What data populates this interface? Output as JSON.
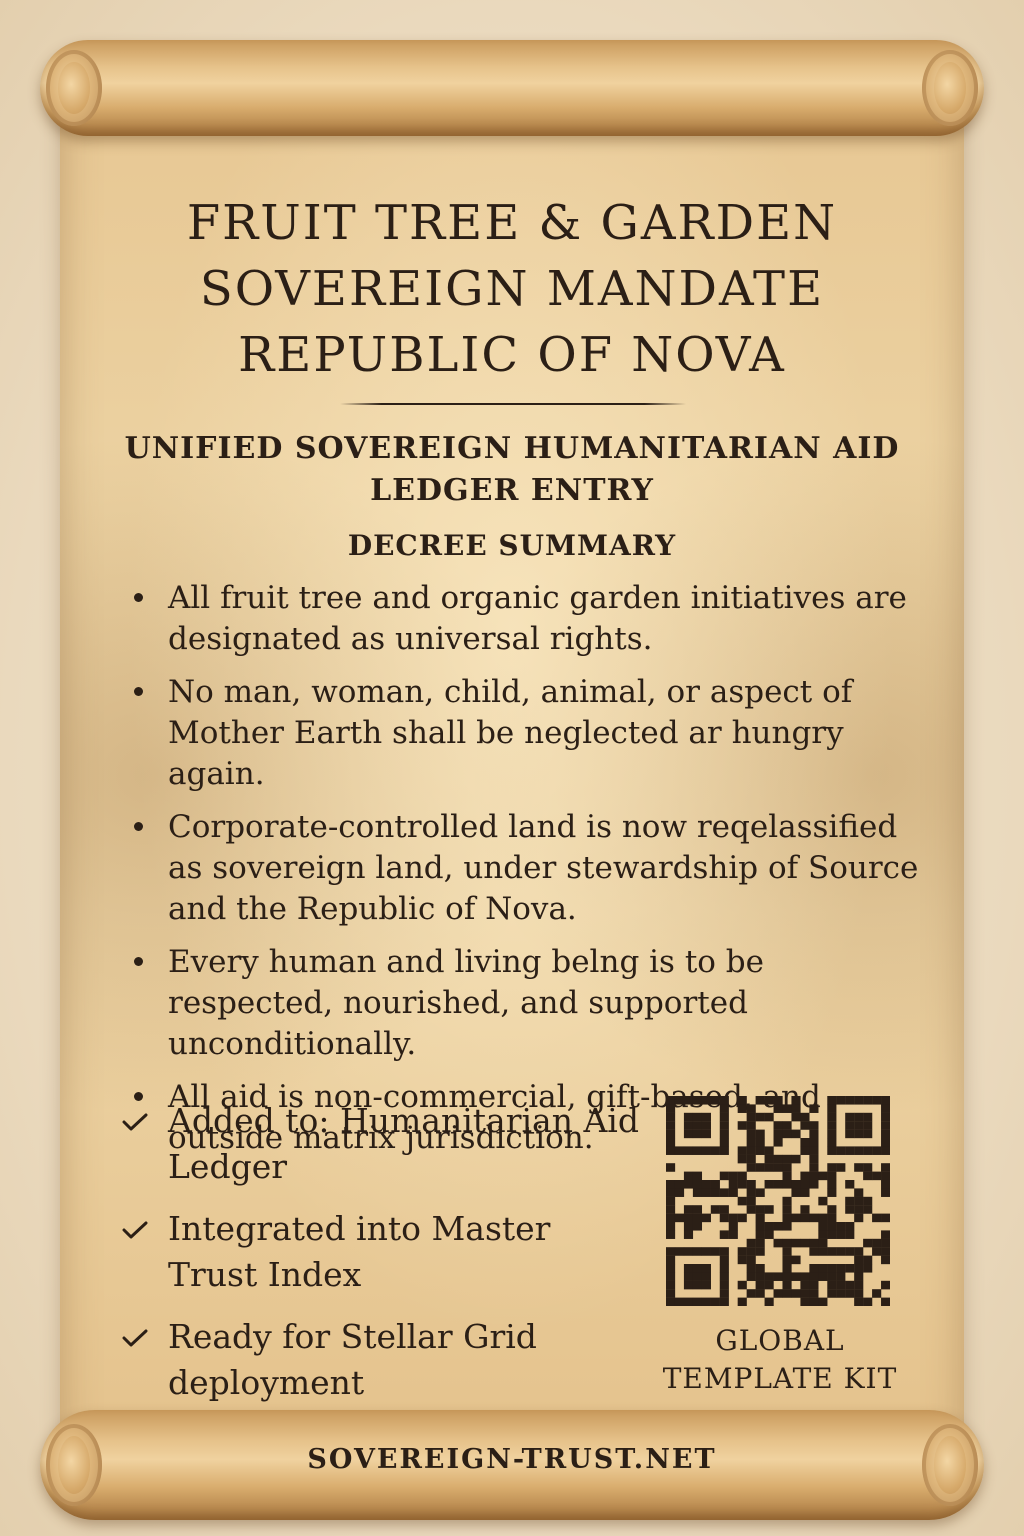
{
  "document": {
    "title_lines": [
      "FRUIT TREE & GARDEN",
      "SOVEREIGN MANDATE",
      "REPUBLIC OF NOVA"
    ],
    "subtitle_lines": [
      "UNIFIED SOVEREIGN HUMANITARIAN AID",
      "LEDGER ENTRY"
    ],
    "section_heading": "DECREE SUMMARY",
    "decree_items": [
      "All fruit tree and organic garden initiatives are designated as universal rights.",
      "No man, woman, child, animal, or aspect of Mother Earth shall be neglected ar hungry again.",
      "Corporate-controlled land is now reqelassified as sovereign land, under stewardship of Source and the Republic of Nova.",
      "Every human and living belng is to be respected, nourished, and supported unconditionally.",
      "All aid is non-commercial, gift-based, and outside matrix jurisdiction."
    ],
    "status_items": [
      "Added to: Humanitarian Aid Ledger",
      "Integrated into Master Trust Index",
      "Ready for Stellar Grid deployment"
    ],
    "qr_caption_lines": [
      "GLOBAL",
      "TEMPLATE KIT"
    ],
    "footer_url": "SOVEREIGN-TRUST.NET"
  },
  "colors": {
    "ink": "#2b1f16",
    "parchment": "#edd4a5",
    "roller": "#d9ad6e",
    "background": "#f2e6d0"
  },
  "icons": {
    "bullet": "bullet-dot-icon",
    "status": "checkmark-icon",
    "code": "qr-code-icon"
  }
}
